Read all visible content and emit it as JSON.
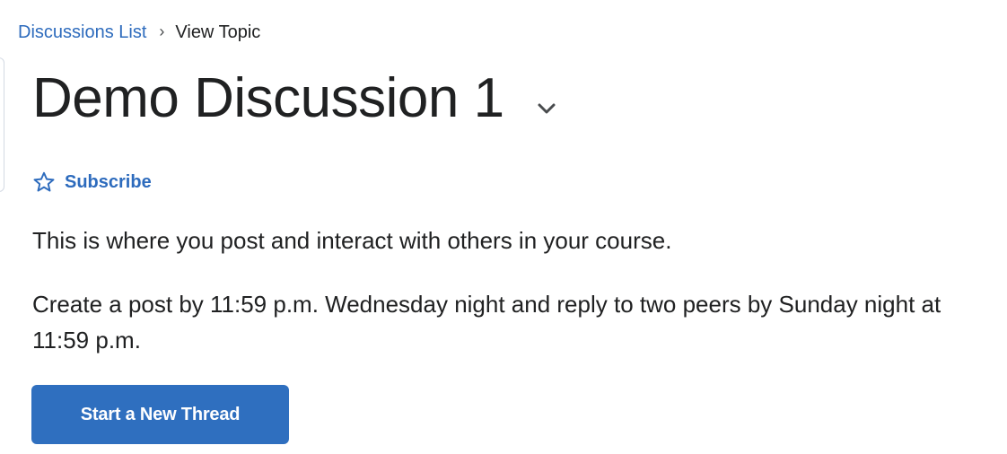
{
  "breadcrumb": {
    "parent_label": "Discussions List",
    "separator": "›",
    "current_label": "View Topic"
  },
  "topic": {
    "title": "Demo Discussion 1",
    "menu_icon": "chevron-down-icon"
  },
  "subscribe": {
    "icon": "star-outline-icon",
    "label": "Subscribe"
  },
  "description": {
    "paragraph_1": "This is where you post and interact with others in your course.",
    "paragraph_2": "Create a post by 11:59 p.m. Wednesday night and reply to two peers by Sunday night at 11:59 p.m."
  },
  "actions": {
    "start_thread_label": "Start a New Thread"
  },
  "colors": {
    "link": "#2d6bbd",
    "primary_button": "#2f6fbf",
    "text": "#202122"
  }
}
